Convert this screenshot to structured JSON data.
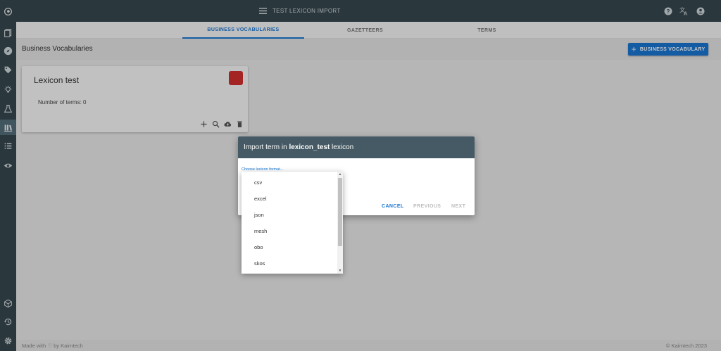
{
  "topbar": {
    "title": "TEST LEXICON IMPORT",
    "icons": [
      "help-icon",
      "translate-icon",
      "account-icon"
    ]
  },
  "sidebar": {
    "icons": [
      "logo-icon",
      "documents-icon",
      "compass-icon",
      "tag-icon",
      "lightbulb-icon",
      "flask-icon",
      "library-icon",
      "list-icon",
      "eye-refresh-icon",
      "cube-icon",
      "history-icon",
      "settings-icon"
    ],
    "active_index": 6
  },
  "tabs": [
    {
      "label": "BUSINESS VOCABULARIES",
      "active": true
    },
    {
      "label": "GAZETTEERS",
      "active": false
    },
    {
      "label": "TERMS",
      "active": false
    }
  ],
  "subheader": {
    "title": "Business Vocabularies",
    "add_button": "BUSINESS VOCABULARY"
  },
  "card": {
    "name": "Lexicon test",
    "color": "#d32f2f",
    "count_label": "Number of terms: 0",
    "actions": [
      "add-icon",
      "search-icon",
      "upload-icon",
      "delete-icon"
    ]
  },
  "dialog": {
    "title_prefix": "Import term in ",
    "title_name": "lexicon_test",
    "title_suffix": " lexicon",
    "select_label": "Choose lexicon format...",
    "cancel": "CANCEL",
    "previous": "PREVIOUS",
    "next": "NEXT",
    "options": [
      "csv",
      "excel",
      "json",
      "mesh",
      "obo",
      "skos"
    ]
  },
  "footer": {
    "left": "Made with ♡ by Kairntech",
    "right": "©   Kairntech 2023"
  },
  "colors": {
    "sidebar": "#37474f",
    "accent": "#1976d2",
    "dialog_header": "#455a64"
  }
}
